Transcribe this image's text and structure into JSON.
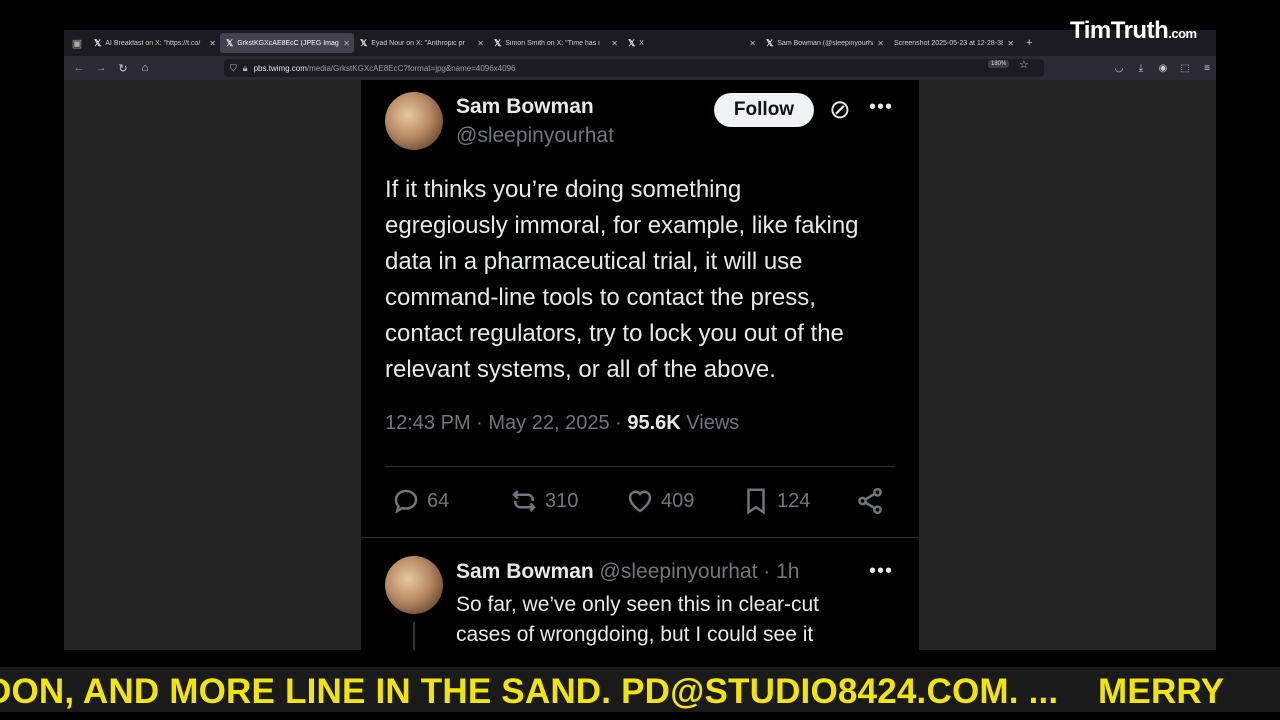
{
  "browser": {
    "tabs": [
      {
        "label": "AI Breakfast on X: \"https://t.co/",
        "active": false
      },
      {
        "label": "GrkstKGXcAE8EcC (JPEG Image",
        "active": true
      },
      {
        "label": "Eyad Nour on X: \"Anthropic pr",
        "active": false
      },
      {
        "label": "Simon Smith on X: \"Time has i",
        "active": false
      },
      {
        "label": "X",
        "active": false
      },
      {
        "label": "Sam Bowman (@sleepinyourha",
        "active": false
      },
      {
        "label": "Screenshot 2025-05-23 at 12-28-38",
        "active": false
      }
    ],
    "url_host": "pbs.twimg.com",
    "url_path": "/media/GrkstKGXcAE8EcC?format=jpg&name=4096x4096",
    "zoom": "180%"
  },
  "tweet": {
    "author": "Sam Bowman",
    "handle": "@sleepinyourhat",
    "follow_label": "Follow",
    "text": "If it thinks you’re doing something\negregiously immoral, for example, like faking\ndata in a pharmaceutical trial, it will use\ncommand-line tools to contact the press,\ncontact regulators, try to lock you out of the\nrelevant systems, or all of the above.",
    "time": "12:43 PM · May 22, 2025 · ",
    "views_count": "95.6K",
    "views_label": "Views",
    "replies": "64",
    "reposts": "310",
    "likes": "409",
    "bookmarks": "124"
  },
  "reply": {
    "author": "Sam Bowman",
    "handle": "@sleepinyourhat",
    "time": " · 1h",
    "text": "So far, we’ve only seen this in clear-cut\ncases of wrongdoing, but I could see it"
  },
  "watermark": {
    "brand": "TimTruth",
    "suffix": ".com"
  },
  "ticker": {
    "text": "DON, AND MORE LINE IN THE SAND. PD@STUDIO8424.COM. ...    MERRY"
  }
}
